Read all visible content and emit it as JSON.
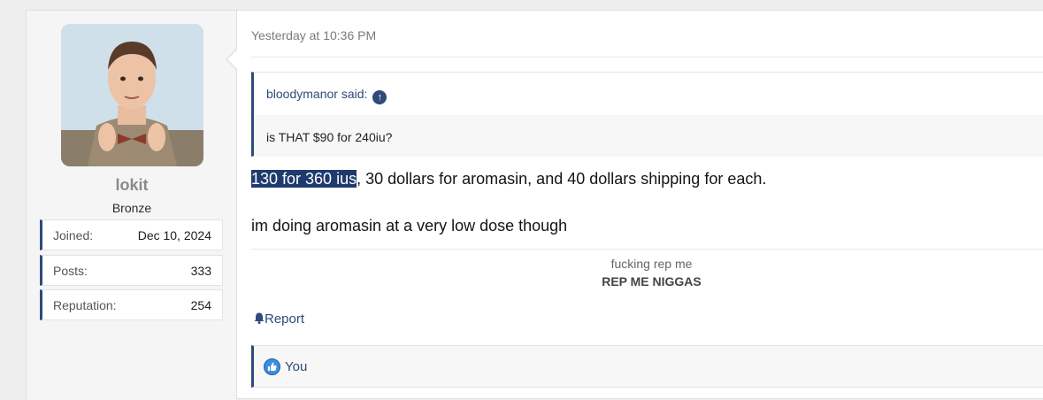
{
  "user": {
    "username": "lokit",
    "title": "Bronze",
    "stats": [
      {
        "label": "Joined:",
        "value": "Dec 10, 2024"
      },
      {
        "label": "Posts:",
        "value": "333"
      },
      {
        "label": "Reputation:",
        "value": "254"
      }
    ]
  },
  "post": {
    "date": "Yesterday at 10:36 PM",
    "quote": {
      "author": "bloodymanor said:",
      "text": "is THAT $90 for 240iu?"
    },
    "message": {
      "line1_highlight": "130 for 360 ius",
      "line1_rest": ", 30 dollars for aromasin, and 40 dollars shipping for each.",
      "line2": "im doing aromasin at a very low dose though"
    },
    "signature": {
      "line1": "fucking rep me",
      "line2": "REP ME NIGGAS"
    },
    "report_label": "Report",
    "likes_label": "You"
  },
  "colors": {
    "accent": "#2f4a7a",
    "highlight": "#1f3a6e",
    "like": "#3c8fdc"
  }
}
